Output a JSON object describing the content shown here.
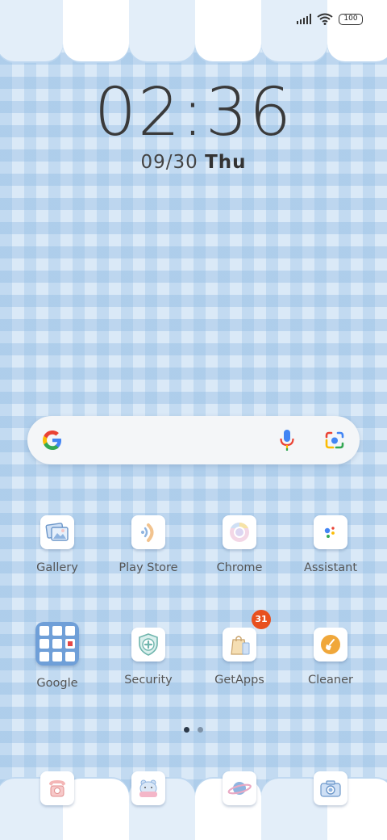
{
  "status_bar": {
    "battery_level": "100"
  },
  "clock": {
    "time": "02:36",
    "date": "09/30",
    "day": "Thu"
  },
  "search": {
    "google_icon": "google-g-icon",
    "mic_icon": "microphone-icon",
    "lens_icon": "google-lens-icon"
  },
  "apps_row1": [
    {
      "label": "Gallery",
      "icon": "gallery-icon"
    },
    {
      "label": "Play Store",
      "icon": "play-store-icon"
    },
    {
      "label": "Chrome",
      "icon": "chrome-icon"
    },
    {
      "label": "Assistant",
      "icon": "assistant-icon"
    }
  ],
  "apps_row2": [
    {
      "label": "Google",
      "icon": "folder-icon"
    },
    {
      "label": "Security",
      "icon": "security-shield-icon"
    },
    {
      "label": "GetApps",
      "icon": "shopping-bag-icon",
      "badge": "31"
    },
    {
      "label": "Cleaner",
      "icon": "broom-icon"
    }
  ],
  "dock": [
    {
      "icon": "phone-icon"
    },
    {
      "icon": "messages-icon"
    },
    {
      "icon": "browser-planet-icon"
    },
    {
      "icon": "camera-icon"
    }
  ],
  "page_indicator": {
    "pages": 2,
    "current": 1
  },
  "colors": {
    "badge": "#e8501e",
    "wallpaper": "#cfe3f5",
    "folder": "#6f9fd8"
  }
}
